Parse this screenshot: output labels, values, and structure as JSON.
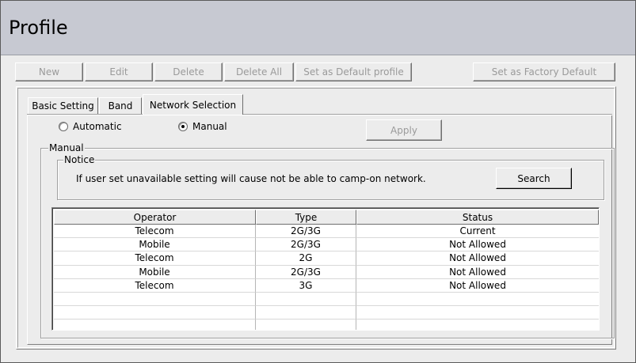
{
  "window": {
    "title": "Profile"
  },
  "toolbar": {
    "new_label": "New",
    "edit_label": "Edit",
    "delete_label": "Delete",
    "delete_all_label": "Delete All",
    "set_default_label": "Set as Default profile",
    "factory_default_label": "Set as Factory Default"
  },
  "tabs": [
    {
      "label": "Basic Setting",
      "active": false
    },
    {
      "label": "Band",
      "active": false
    },
    {
      "label": "Network Selection",
      "active": true
    }
  ],
  "network_selection": {
    "mode_automatic_label": "Automatic",
    "mode_manual_label": "Manual",
    "selected_mode": "Manual",
    "apply_label": "Apply",
    "manual_group_label": "Manual",
    "notice_group_label": "Notice",
    "notice_text": "If user set unavailable setting will cause  not be able to camp-on network.",
    "search_label": "Search"
  },
  "operator_table": {
    "columns": [
      "Operator",
      "Type",
      "Status"
    ],
    "rows": [
      [
        "Telecom",
        "2G/3G",
        "Current"
      ],
      [
        "Mobile",
        "2G/3G",
        "Not Allowed"
      ],
      [
        "Telecom",
        "2G",
        "Not Allowed"
      ],
      [
        "Mobile",
        "2G/3G",
        "Not Allowed"
      ],
      [
        "Telecom",
        "3G",
        "Not Allowed"
      ],
      [
        "",
        "",
        ""
      ],
      [
        "",
        "",
        ""
      ],
      [
        "",
        "",
        ""
      ]
    ]
  },
  "colors": {
    "titlebar": "#c7c9d2",
    "background": "#ececec",
    "disabled_text": "#9a9a9a"
  }
}
